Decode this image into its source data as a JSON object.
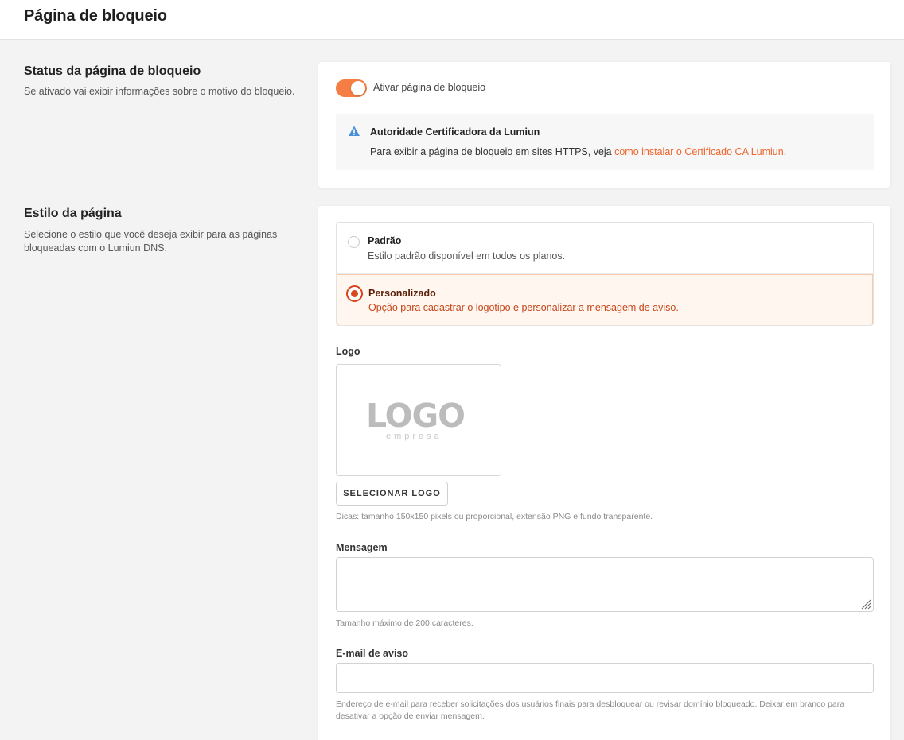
{
  "header": {
    "title": "Página de bloqueio"
  },
  "status_section": {
    "title": "Status da página de bloqueio",
    "description": "Se ativado vai exibir informações sobre o motivo do bloqueio.",
    "toggle": {
      "label": "Ativar página de bloqueio",
      "enabled": true,
      "color": "#f47e43"
    },
    "alert": {
      "icon": "warning-triangle-icon",
      "title": "Autoridade Certificadora da Lumiun",
      "text_prefix": "Para exibir a página de bloqueio em sites HTTPS, veja ",
      "link_text": "como instalar o Certificado CA Lumiun",
      "text_suffix": "."
    }
  },
  "style_section": {
    "title": "Estilo da página",
    "description": "Selecione o estilo que você deseja exibir para as páginas bloqueadas com o Lumiun DNS.",
    "options": [
      {
        "title": "Padrão",
        "subtitle": "Estilo padrão disponível em todos os planos.",
        "selected": false
      },
      {
        "title": "Personalizado",
        "subtitle": "Opção para cadastrar o logotipo e personalizar a mensagem de aviso.",
        "selected": true
      }
    ],
    "accent_color": "#d9431a"
  },
  "logo_field": {
    "label": "Logo",
    "placeholder_big": "LOGO",
    "placeholder_small": "empresa",
    "button_label": "SELECIONAR LOGO",
    "hint": "Dicas: tamanho 150x150 pixels ou proporcional, extensão PNG e fundo transparente."
  },
  "message_field": {
    "label": "Mensagem",
    "value": "",
    "hint": "Tamanho máximo de 200 caracteres."
  },
  "email_field": {
    "label": "E-mail de aviso",
    "value": "",
    "hint": "Endereço de e-mail para receber solicitações dos usuários finais para desbloquear ou revisar domínio bloqueado. Deixar em branco para desativar a opção de enviar mensagem."
  }
}
